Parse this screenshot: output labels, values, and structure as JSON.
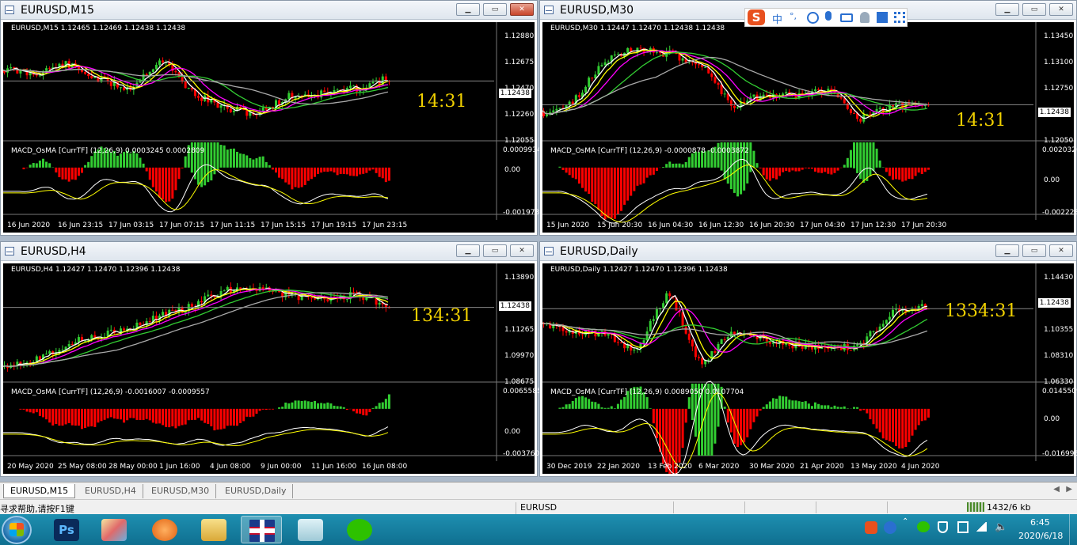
{
  "windows": [
    {
      "title": "EURUSD,M15",
      "info": "EURUSD,M15  1.12465 1.12469 1.12438 1.12438",
      "macd": "MACD_OsMA [CurrTF] (12,26,9) 0.0003245 0.0002809",
      "clock": "14:31",
      "prices": [
        "1.12880",
        "1.12675",
        "1.12470",
        "1.12438",
        "1.12260",
        "1.12055"
      ],
      "macd_scale": [
        "0.0009934",
        "0.00",
        "-0.001973"
      ],
      "dates": [
        "16 Jun 2020",
        "16 Jun 23:15",
        "17 Jun 03:15",
        "17 Jun 07:15",
        "17 Jun 11:15",
        "17 Jun 15:15",
        "17 Jun 19:15",
        "17 Jun 23:15"
      ]
    },
    {
      "title": "EURUSD,M30",
      "info": "EURUSD,M30  1.12447 1.12470 1.12438 1.12438",
      "macd": "MACD_OsMA [CurrTF] (12,26,9) -0.0000878 -0.0003872",
      "clock": "14:31",
      "prices": [
        "1.13450",
        "1.13100",
        "1.12750",
        "1.12438",
        "1.12050"
      ],
      "macd_scale": [
        "0.0020326",
        "0.00",
        "-0.002223"
      ],
      "dates": [
        "15 Jun 2020",
        "15 Jun 20:30",
        "16 Jun 04:30",
        "16 Jun 12:30",
        "16 Jun 20:30",
        "17 Jun 04:30",
        "17 Jun 12:30",
        "17 Jun 20:30"
      ]
    },
    {
      "title": "EURUSD,H4",
      "info": "EURUSD,H4  1.12427 1.12470 1.12396 1.12438",
      "macd": "MACD_OsMA [CurrTF] (12,26,9) -0.0016007 -0.0009557",
      "clock": "134:31",
      "prices": [
        "1.13890",
        "1.12438",
        "1.11265",
        "1.09970",
        "1.08675"
      ],
      "macd_scale": [
        "0.0065585",
        "0.00",
        "-0.003760"
      ],
      "dates": [
        "20 May 2020",
        "25 May 08:00",
        "28 May 00:00",
        "1 Jun 16:00",
        "4 Jun 08:00",
        "9 Jun 00:00",
        "11 Jun 16:00",
        "16 Jun 08:00"
      ]
    },
    {
      "title": "EURUSD,Daily",
      "info": "EURUSD,Daily  1.12427 1.12470 1.12396 1.12438",
      "macd": "MACD_OsMA [CurrTF] (12,26,9) 0.0089050 0.0107704",
      "clock": "1334:31",
      "prices": [
        "1.14430",
        "1.12438",
        "1.10355",
        "1.08310",
        "1.06330"
      ],
      "macd_scale": [
        "0.0145509",
        "0.00",
        "-0.016995"
      ],
      "dates": [
        "30 Dec 2019",
        "22 Jan 2020",
        "13 Feb 2020",
        "6 Mar 2020",
        "30 Mar 2020",
        "21 Apr 2020",
        "13 May 2020",
        "4 Jun 2020"
      ]
    }
  ],
  "tabs": [
    "EURUSD,M15",
    "EURUSD,H4",
    "EURUSD,M30",
    "EURUSD,Daily"
  ],
  "status": {
    "help": "寻求帮助,请按F1键",
    "symbol": "EURUSD",
    "traffic": "1432/6 kb"
  },
  "ime": {
    "lang": "中",
    "punct": "°,"
  },
  "clock": {
    "time": "6:45",
    "date": "2020/6/18"
  },
  "colors": {
    "bg": "#000000",
    "bull": "#32cd32",
    "bear": "#ff0000",
    "ma_fast": "#ffffff",
    "ma_yellow": "#ffff00",
    "ma_magenta": "#ff00ff",
    "ma_green": "#32cd32",
    "ma_gray": "#a9a9a9",
    "clock": "#f0d000"
  }
}
